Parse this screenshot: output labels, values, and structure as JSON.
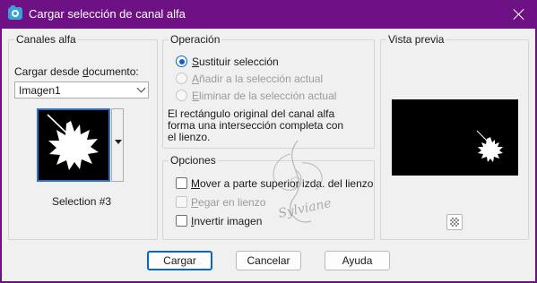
{
  "window": {
    "title": "Cargar selección de canal alfa",
    "app_icon": "camera-icon",
    "close_icon": "close-icon"
  },
  "canales": {
    "group_label": "Canales alfa",
    "load_label_pre": "Cargar desde ",
    "load_label_u": "d",
    "load_label_post": "ocumento:",
    "document_value": "Imagen1",
    "selection_name": "Selection #3"
  },
  "operacion": {
    "group_label": "Operación",
    "options": [
      {
        "u": "S",
        "rest": "ustituir selección",
        "selected": true,
        "enabled": true
      },
      {
        "u": "A",
        "rest": "ñadir a la selección actual",
        "selected": false,
        "enabled": false
      },
      {
        "u": "E",
        "rest": "liminar de la selección actual",
        "selected": false,
        "enabled": false
      }
    ],
    "description_line1": "El rectángulo original del canal alfa",
    "description_line2": "forma una intersección completa con",
    "description_line3": "el lienzo."
  },
  "opciones": {
    "group_label": "Opciones",
    "items": [
      {
        "u": "M",
        "rest": "over a parte superior izda. del lienzo",
        "checked": false,
        "enabled": true
      },
      {
        "u": "P",
        "rest": "egar en lienzo",
        "checked": false,
        "enabled": false
      },
      {
        "u": "I",
        "rest": "nvertir imagen",
        "checked": false,
        "enabled": true
      }
    ]
  },
  "preview": {
    "group_label": "Vista previa",
    "checker_icon": "transparency-checker-icon"
  },
  "buttons": {
    "load": "Cargar",
    "cancel": "Cancelar",
    "help": "Ayuda"
  },
  "watermark": "Sylviane",
  "colors": {
    "titlebar": "#6e1184",
    "accent": "#0a64c4",
    "dialog_bg": "#f0f0f0"
  }
}
